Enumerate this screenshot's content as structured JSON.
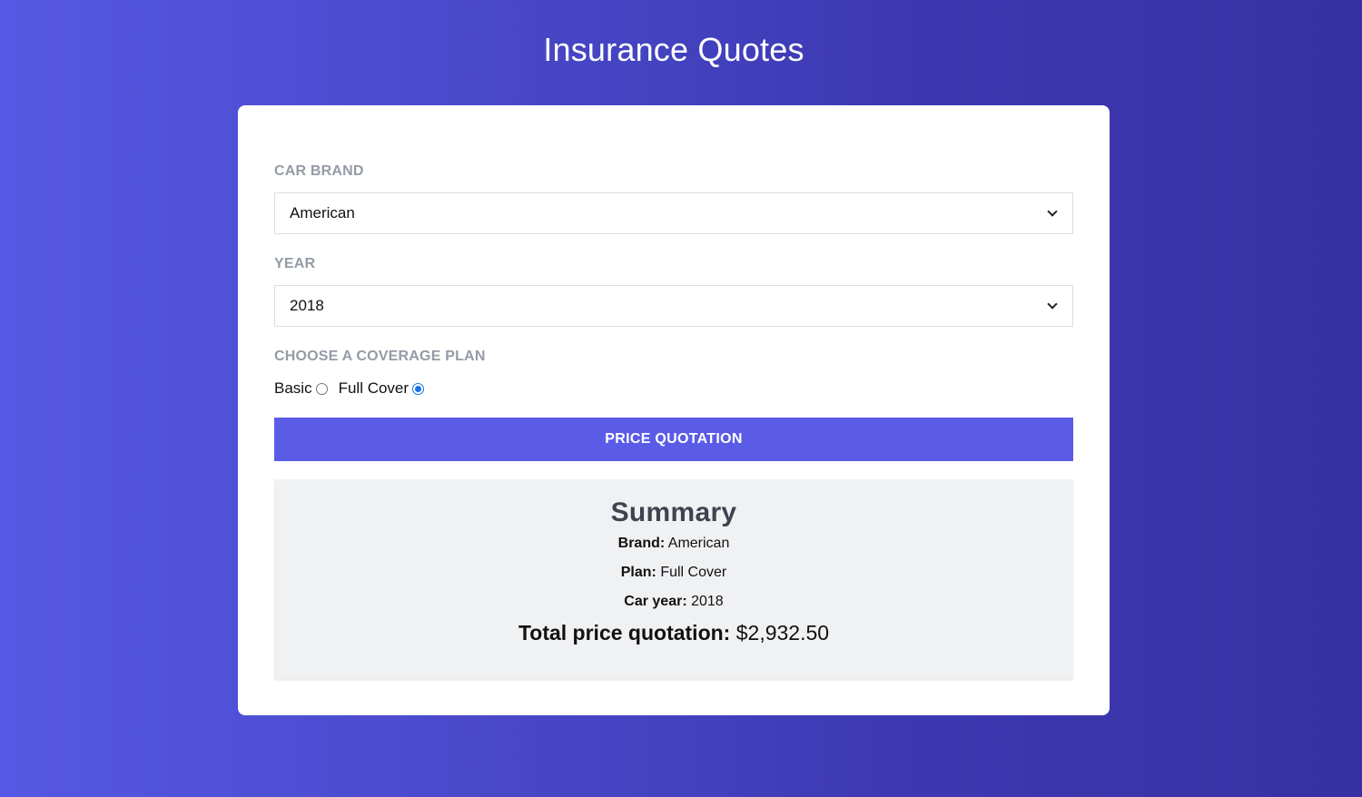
{
  "header": {
    "title": "Insurance Quotes"
  },
  "form": {
    "brand_label": "Car Brand",
    "brand_value": "American",
    "year_label": "Year",
    "year_value": "2018",
    "plan_label": "Choose a coverage plan",
    "plan_options": [
      {
        "label": "Basic",
        "checked": false
      },
      {
        "label": "Full Cover",
        "checked": true
      }
    ],
    "submit_label": "Price Quotation"
  },
  "summary": {
    "title": "Summary",
    "brand_key": "Brand:",
    "brand_value": "American",
    "plan_key": "Plan:",
    "plan_value": "Full Cover",
    "year_key": "Car year:",
    "year_value": "2018",
    "total_key": "Total price quotation:",
    "total_value": "$2,932.50"
  },
  "colors": {
    "accent": "#5a5ce8",
    "background_start": "#5558e4",
    "background_end": "#3631a3",
    "label": "#949ba5"
  }
}
